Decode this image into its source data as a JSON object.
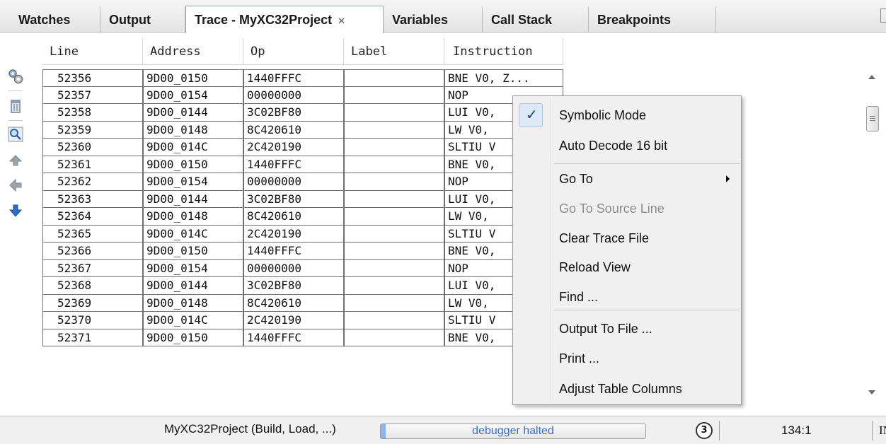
{
  "tabs": [
    {
      "label": "Watches"
    },
    {
      "label": "Output"
    },
    {
      "label": "Trace - MyXC32Project",
      "close_icon": "close-icon",
      "active": true
    },
    {
      "label": "Variables"
    },
    {
      "label": "Call Stack"
    },
    {
      "label": "Breakpoints"
    }
  ],
  "toolbar": {
    "icons": [
      "settings-gears-icon",
      "trash-icon",
      "magnifier-icon",
      "arrow-up-icon",
      "arrow-left-icon",
      "arrow-down-icon"
    ]
  },
  "table": {
    "columns": [
      "Line",
      "Address",
      "Op",
      "Label",
      "Instruction"
    ],
    "rows": [
      [
        "52356",
        "9D00_0150",
        "1440FFFC",
        "",
        "BNE V0, Z..."
      ],
      [
        "52357",
        "9D00_0154",
        "00000000",
        "",
        "NOP"
      ],
      [
        "52358",
        "9D00_0144",
        "3C02BF80",
        "",
        "LUI V0,"
      ],
      [
        "52359",
        "9D00_0148",
        "8C420610",
        "",
        "LW V0,"
      ],
      [
        "52360",
        "9D00_014C",
        "2C420190",
        "",
        "SLTIU V"
      ],
      [
        "52361",
        "9D00_0150",
        "1440FFFC",
        "",
        "BNE V0,"
      ],
      [
        "52362",
        "9D00_0154",
        "00000000",
        "",
        "NOP"
      ],
      [
        "52363",
        "9D00_0144",
        "3C02BF80",
        "",
        "LUI V0,"
      ],
      [
        "52364",
        "9D00_0148",
        "8C420610",
        "",
        "LW V0,"
      ],
      [
        "52365",
        "9D00_014C",
        "2C420190",
        "",
        "SLTIU V"
      ],
      [
        "52366",
        "9D00_0150",
        "1440FFFC",
        "",
        "BNE V0,"
      ],
      [
        "52367",
        "9D00_0154",
        "00000000",
        "",
        "NOP"
      ],
      [
        "52368",
        "9D00_0144",
        "3C02BF80",
        "",
        "LUI V0,"
      ],
      [
        "52369",
        "9D00_0148",
        "8C420610",
        "",
        "LW V0,"
      ],
      [
        "52370",
        "9D00_014C",
        "2C420190",
        "",
        "SLTIU V"
      ],
      [
        "52371",
        "9D00_0150",
        "1440FFFC",
        "",
        "BNE V0,"
      ]
    ]
  },
  "context_menu": {
    "items": [
      {
        "label": "Symbolic Mode",
        "checked": true,
        "check_mark": "✓"
      },
      {
        "label": "Auto Decode 16 bit"
      },
      {
        "label": "Go To",
        "submenu": true
      },
      {
        "label": "Go To Source Line",
        "disabled": true
      },
      {
        "label": "Clear Trace File"
      },
      {
        "label": "Reload View"
      },
      {
        "label": "Find ..."
      },
      {
        "label": "Output To File ..."
      },
      {
        "label": "Print ..."
      },
      {
        "label": "Adjust Table Columns"
      }
    ]
  },
  "status_bar": {
    "project": "MyXC32Project (Build, Load, ...)",
    "progress_text": "debugger halted",
    "progress_fraction": 0.02,
    "notification_count": "3",
    "position": "134:1",
    "mode": "IN"
  },
  "colors": {
    "accent": "#3a6fc0",
    "menu_bg": "#f0f0f0",
    "check_bg": "#dde9f7",
    "progress_fill": "#8db6e8"
  }
}
